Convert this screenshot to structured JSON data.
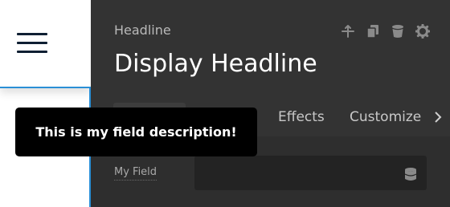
{
  "app": {
    "menu_icon": "hamburger-menu-icon"
  },
  "header": {
    "eyebrow": "Headline",
    "title": "Display Headline",
    "toolbar_icons": [
      "move-icon",
      "duplicate-icon",
      "delete-icon",
      "settings-icon"
    ]
  },
  "tabs": {
    "items": [
      "Effects",
      "Customize"
    ],
    "next_icon": "chevron-right-icon"
  },
  "field": {
    "label": "My Field",
    "value": "",
    "icon": "database-icon"
  },
  "tooltip": {
    "text": "This is my field description!"
  },
  "colors": {
    "accent": "#2a8fd6",
    "panel": "#333333",
    "tooltip_bg": "#000000"
  }
}
